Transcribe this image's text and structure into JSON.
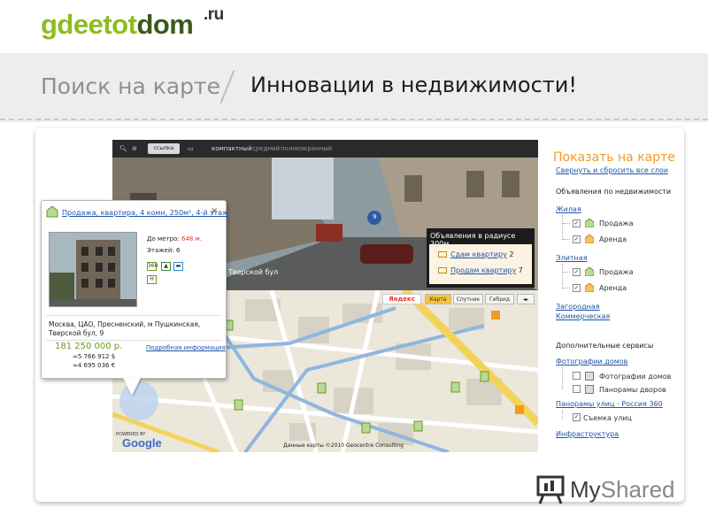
{
  "logo": {
    "part1": "gdeetot",
    "part2": "dom",
    "tld": ".ru"
  },
  "header": {
    "title": "Поиск на карте",
    "subtitle": "Инновации в недвижимости!"
  },
  "street_view": {
    "toolbar": {
      "links_label": "ссылка",
      "tabs": [
        "компактный",
        "средний",
        "полноэкранный"
      ]
    },
    "marker_label": "9",
    "street_label": "Тверской бул",
    "panel": {
      "header": "Объявления в радиусе 300м.",
      "rows": [
        {
          "label": "Сдам квартиру",
          "count": "2"
        },
        {
          "label": "Продам квартиру",
          "count": "7"
        }
      ]
    }
  },
  "map": {
    "yandex": "Яндекс",
    "tabs": [
      "Карта",
      "Спутник",
      "Гибрид"
    ],
    "active_tab": "Карта",
    "credit": "Данные карты ©2010 Geocentre Consulting",
    "powered": "POWERED BY",
    "google": "Google"
  },
  "popup": {
    "title_link": "Продажа, квартира, 4 комн, 250м², 4-й этаж",
    "close": "×",
    "metro_label": "До метро:",
    "metro_value": "648 м.",
    "floors_label": "Этажей:",
    "floors_value": "6",
    "badges": [
      "360",
      "H"
    ],
    "address": "Москва, ЦАО, Пресненский, м Пушкинская, Тверской бул, 9",
    "address_line1": "Москва, ЦАО, Пресненский, м Пушкинская,",
    "address_line2": "Тверской бул, 9",
    "price": "181 250 000 р.",
    "price_usd": "≈5 766 912 $",
    "price_eur": "≈4 695 036 €",
    "more_link": "Подробная информация"
  },
  "right_panel": {
    "title": "Показать на карте",
    "reset_link": "Свернуть и сбросить все слои",
    "section_realty": "Объявления по недвижимости",
    "groups": [
      {
        "label": "Жилая",
        "items": [
          "Продажа",
          "Аренда"
        ]
      },
      {
        "label": "Элитная",
        "items": [
          "Продажа",
          "Аренда"
        ]
      }
    ],
    "link_country": "Загородная",
    "link_commercial": "Коммерческая",
    "section_services": "Дополнительные сервисы",
    "photos_link": "Фотографии домов",
    "photos_items": [
      "Фотографии домов",
      "Панорамы дворов"
    ],
    "panorama_link": "Панорамы улиц - Россия 360",
    "panorama_items": [
      "Съемка улиц"
    ],
    "infra_link": "Инфраструктура"
  },
  "watermark": {
    "my": "My",
    "shared": "Shared"
  },
  "colors": {
    "accent_orange": "#f39a1f",
    "brand_green": "#8cbd1c",
    "link_blue": "#1f55a8"
  }
}
